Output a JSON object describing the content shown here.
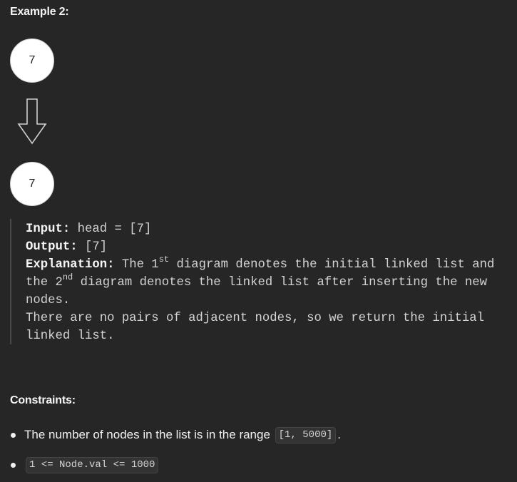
{
  "example": {
    "title": "Example 2:",
    "diagram": {
      "before_node": "7",
      "after_node": "7"
    },
    "input_label": "Input:",
    "input_value": " head = [7]",
    "output_label": "Output:",
    "output_value": " [7]",
    "explanation_label": "Explanation:",
    "explanation_text_1": " The 1",
    "explanation_sup_1": "st",
    "explanation_text_2": " diagram denotes the initial linked list and",
    "explanation_text_3": "the 2",
    "explanation_sup_2": "nd",
    "explanation_text_4": " diagram denotes the linked list after inserting the new",
    "explanation_text_5": "nodes.",
    "explanation_line_2": "There are no pairs of adjacent nodes, so we return the initial",
    "explanation_line_3": "linked list."
  },
  "constraints": {
    "title": "Constraints:",
    "item1_text": "The number of nodes in the list is in the range ",
    "item1_code": "[1, 5000]",
    "item1_suffix": ".",
    "item2_code": "1 <= Node.val <= 1000"
  },
  "colors": {
    "background": "#262626",
    "node_fill": "#ffffff",
    "text": "#e6e6e6"
  }
}
